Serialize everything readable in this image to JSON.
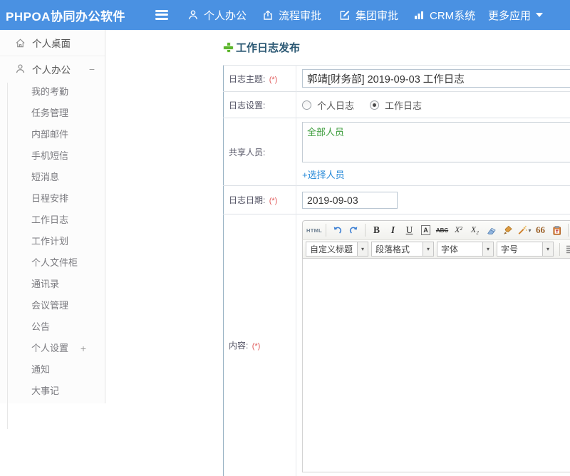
{
  "header": {
    "brand": "PHPOA协同办公软件",
    "nav": [
      {
        "label": "个人办公"
      },
      {
        "label": "流程审批"
      },
      {
        "label": "集团审批"
      },
      {
        "label": "CRM系统"
      },
      {
        "label": "更多应用"
      }
    ]
  },
  "sidebar": {
    "desktop": {
      "label": "个人桌面"
    },
    "office": {
      "label": "个人办公",
      "toggle": "−"
    },
    "sub_items": [
      "我的考勤",
      "任务管理",
      "内部邮件",
      "手机短信",
      "短消息",
      "日程安排",
      "工作日志",
      "工作计划",
      "个人文件柜",
      "通讯录",
      "会议管理",
      "公告",
      "个人设置",
      "通知",
      "大事记"
    ],
    "settings_toggle": "+"
  },
  "main": {
    "page_title": "工作日志发布",
    "form": {
      "subject": {
        "label": "日志主题:",
        "required": "(*)",
        "value": "郭靖[财务部] 2019-09-03 工作日志"
      },
      "type": {
        "label": "日志设置:",
        "options": [
          {
            "label": "个人日志",
            "checked": false
          },
          {
            "label": "工作日志",
            "checked": true
          }
        ]
      },
      "share": {
        "label": "共享人员:",
        "value": "全部人员",
        "action": "+选择人员"
      },
      "date": {
        "label": "日志日期:",
        "required": "(*)",
        "value": "2019-09-03"
      },
      "content": {
        "label": "内容:",
        "required": "(*)"
      }
    },
    "editor": {
      "source": "HTML",
      "bold": "B",
      "italic": "I",
      "underline": "U",
      "font_border": "A",
      "strike": "ABC",
      "superscript": "X²",
      "subscript": "X₂",
      "quote": "66",
      "font_color": "A",
      "caret": "▾",
      "dropdowns": [
        "自定义标题",
        "段落格式",
        "字体",
        "字号"
      ]
    }
  },
  "colors": {
    "header_bg": "#4a91e2",
    "link_blue": "#2a8bd9",
    "member_green": "#3f9e3f",
    "title_navy": "#2b5873",
    "required_red": "#e05a5a",
    "add_green": "#5cb52d"
  }
}
